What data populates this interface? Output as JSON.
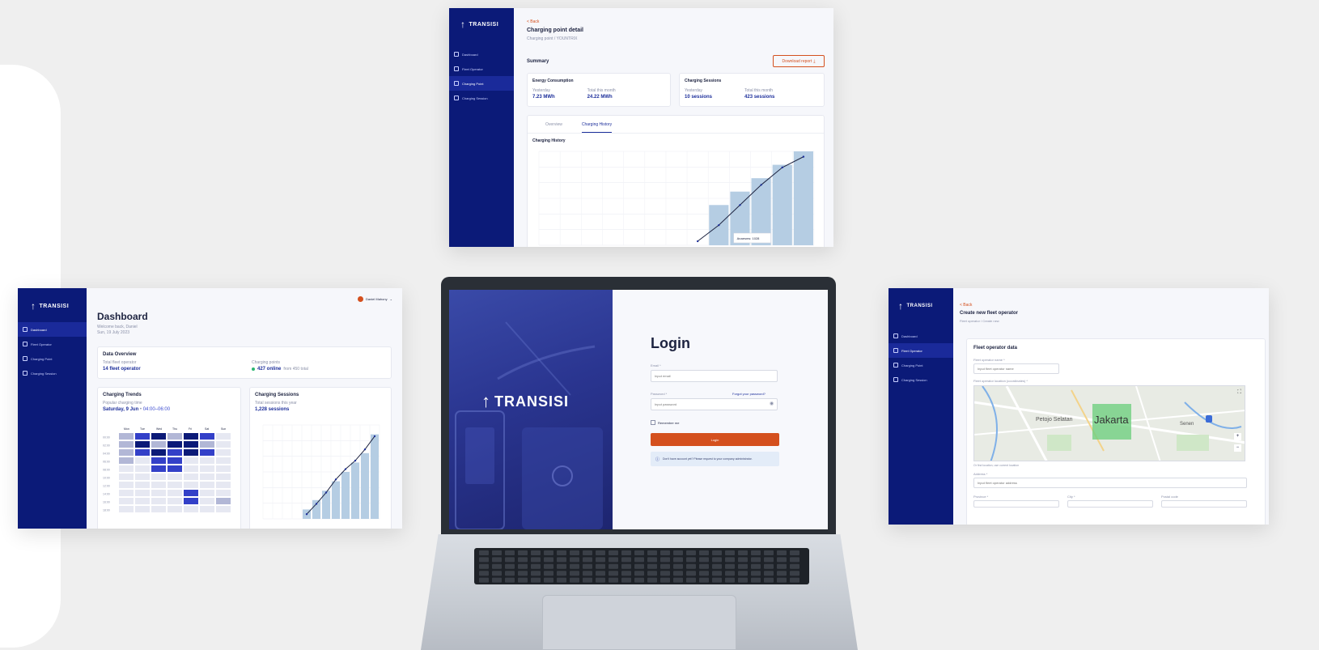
{
  "brand": {
    "name": "TRANSISI"
  },
  "sidebar": {
    "items": [
      "Dashboard",
      "Fleet Operator",
      "Charging Point",
      "Charging Session"
    ]
  },
  "charging_detail": {
    "back": "< Back",
    "title": "Charging point detail",
    "breadcrumb": "Charging point  /  YOUNTRIX",
    "summary": "Summary",
    "download": "Download report",
    "energy_title": "Energy Consumption",
    "yesterday_label": "Yesterday",
    "yesterday_value": "7.23 MWh",
    "month_label": "Total this month",
    "month_value": "24.22 MWh",
    "sessions_title": "Charging Sessions",
    "sessions_yesterday_value": "10 sessions",
    "sessions_month_value": "423 sessions",
    "tab_overview": "Overview",
    "tab_history": "Charging History",
    "chart_title": "Charging History",
    "tooltip": "Anaesms: 1028"
  },
  "dashboard": {
    "user": "Daniel Mahony",
    "title": "Dashboard",
    "welcome": "Welcome back, Daniel",
    "date": "Sun, 19 July 2023",
    "overview_title": "Data Overview",
    "fleet_label": "Total fleet operator",
    "fleet_value": "14 fleet operator",
    "points_label": "Charging points",
    "points_value": "427 online",
    "points_extra": "from 450 total",
    "trends_title": "Charging Trends",
    "popular_label": "Popular charging time",
    "popular_value": "Saturday, 9 Jun",
    "popular_time": "04:00–06:00",
    "days": [
      "Mon",
      "Tue",
      "Wed",
      "Thu",
      "Fri",
      "Sat",
      "Sun"
    ],
    "hours": [
      "00:00",
      "02:00",
      "04:00",
      "06:00",
      "08:00",
      "10:00",
      "12:00",
      "14:00",
      "16:00",
      "18:00"
    ],
    "sessions_title": "Charging Sessions",
    "sessions_label": "Total sessions this year",
    "sessions_value": "1,228 sessions"
  },
  "login": {
    "title": "Login",
    "email_label": "Email *",
    "email_placeholder": "Input email",
    "password_label": "Password *",
    "forgot": "Forgot your password?",
    "password_placeholder": "Input password",
    "remember": "Remember me",
    "button": "Login",
    "info": "Don't have account yet? Please request to your company administrator."
  },
  "fleet_form": {
    "back": "< Back",
    "title": "Create new fleet operator",
    "breadcrumb": "Fleet operator  /  Create new",
    "section": "Fleet operator data",
    "name_label": "Fleet operator name *",
    "name_placeholder": "Input fleet operator name",
    "location_label": "Fleet operator location (coordinates) *",
    "map_city": "Jakarta",
    "map_district": "Petojo Selatan",
    "map_area": "Senen",
    "use_location": "Or find location, use current location",
    "address_label": "Address *",
    "address_placeholder": "Input fleet operator address",
    "province_label": "Province *",
    "city_label": "City *",
    "postal_label": "Postal code"
  },
  "charts": {
    "history_bars": [
      0,
      0,
      0,
      0,
      0,
      0,
      0,
      0,
      3,
      4,
      5,
      6,
      7
    ],
    "history_line": [
      0,
      0,
      0,
      0,
      0,
      0,
      0,
      0.3,
      1.5,
      3,
      4.5,
      5.8,
      6.6
    ],
    "sessions_bars": [
      0,
      0,
      0,
      0,
      1,
      2,
      3,
      4,
      5,
      6,
      7,
      9
    ],
    "sessions_line": [
      0,
      0,
      0,
      0,
      0.5,
      1.6,
      2.8,
      4.2,
      5.3,
      6.2,
      7.4,
      8.8
    ]
  },
  "colors": {
    "navy": "#0b1a78",
    "accent": "#d4501e",
    "bar": "#b5cde3"
  }
}
